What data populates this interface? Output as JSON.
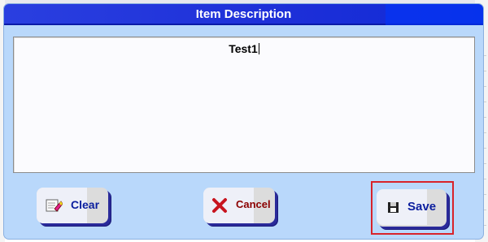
{
  "dialog": {
    "title": "Item Description"
  },
  "description": {
    "value": "Test1"
  },
  "buttons": {
    "clear": {
      "label": "Clear",
      "icon": "eraser-icon"
    },
    "cancel": {
      "label": "Cancel",
      "icon": "x-icon"
    },
    "save": {
      "label": "Save",
      "icon": "floppy-disk-icon"
    }
  },
  "colors": {
    "dialog_bg": "#b9d8fb",
    "titlebar": "#1d2fd8",
    "button_text": "#0b1e9e",
    "cancel_text": "#8b0000",
    "highlight": "#d9232a"
  }
}
